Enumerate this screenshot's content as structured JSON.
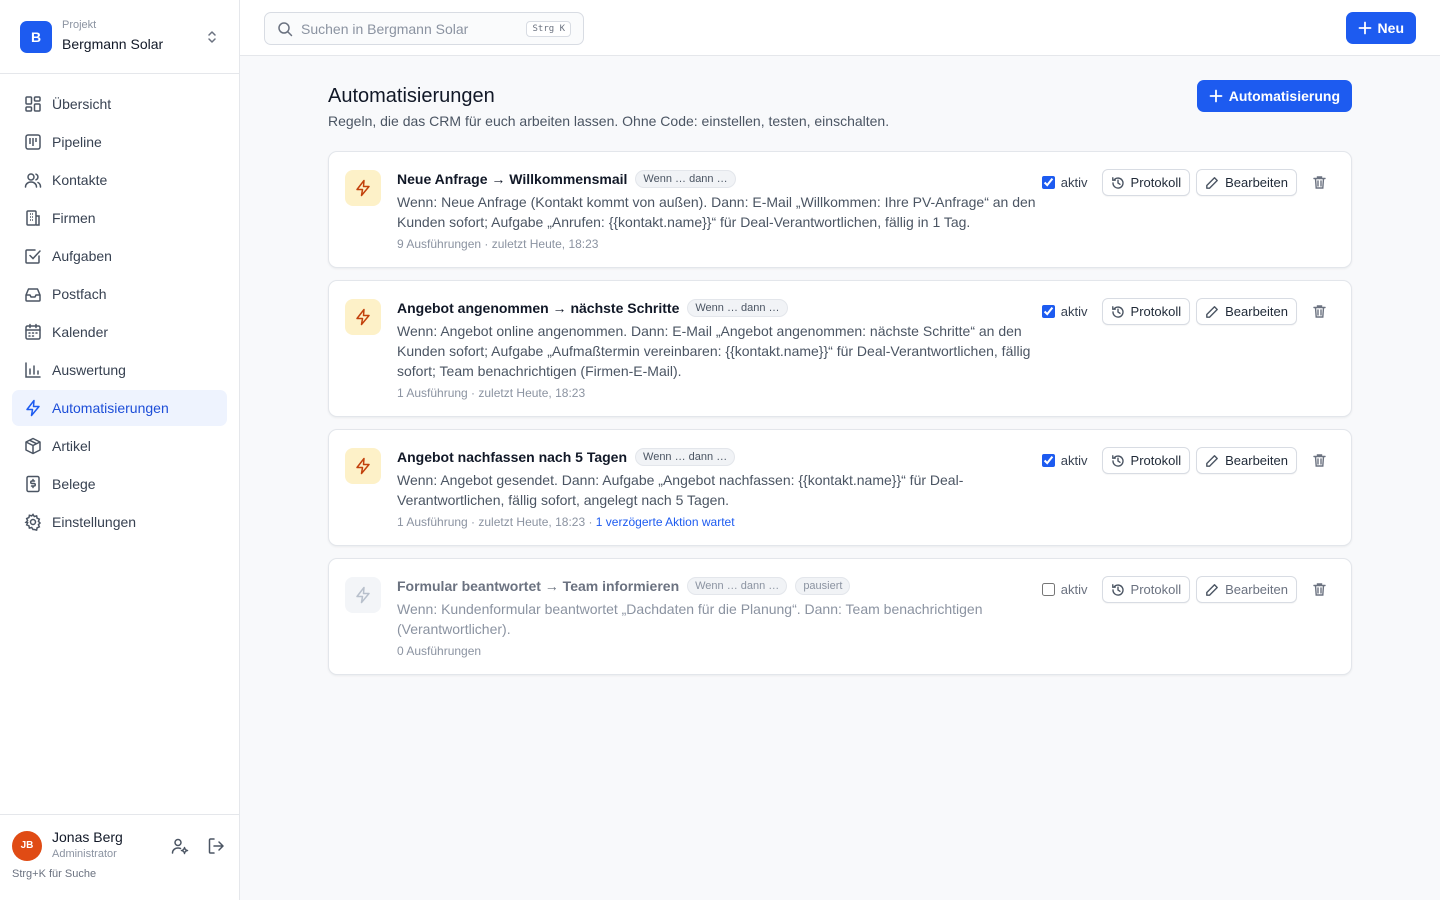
{
  "project": {
    "kicker": "Projekt",
    "name": "Bergmann Solar",
    "logo_letter": "B"
  },
  "nav": [
    {
      "label": "Übersicht",
      "icon": "dashboard-icon"
    },
    {
      "label": "Pipeline",
      "icon": "pipeline-icon"
    },
    {
      "label": "Kontakte",
      "icon": "users-icon"
    },
    {
      "label": "Firmen",
      "icon": "building-icon"
    },
    {
      "label": "Aufgaben",
      "icon": "checkbox-icon"
    },
    {
      "label": "Postfach",
      "icon": "inbox-icon"
    },
    {
      "label": "Kalender",
      "icon": "calendar-icon"
    },
    {
      "label": "Auswertung",
      "icon": "chart-icon"
    },
    {
      "label": "Automatisierungen",
      "icon": "bolt-icon",
      "active": true
    },
    {
      "label": "Artikel",
      "icon": "package-icon"
    },
    {
      "label": "Belege",
      "icon": "receipt-icon"
    },
    {
      "label": "Einstellungen",
      "icon": "gear-icon"
    }
  ],
  "user": {
    "initials": "JB",
    "name": "Jonas Berg",
    "role": "Administrator",
    "hint": "Strg+K für Suche"
  },
  "search": {
    "placeholder": "Suchen in Bergmann Solar",
    "shortcut": "Strg K"
  },
  "topbar": {
    "new_label": "Neu"
  },
  "page": {
    "title": "Automatisierungen",
    "subtitle": "Regeln, die das CRM für euch arbeiten lassen. Ohne Code: einstellen, testen, einschalten.",
    "add_label": "Automatisierung"
  },
  "labels": {
    "active": "aktiv",
    "log": "Protokoll",
    "edit": "Bearbeiten"
  },
  "automations": [
    {
      "title": "Neue Anfrage → Willkommensmail",
      "chip": "Wenn … dann …",
      "description": "Wenn: Neue Anfrage (Kontakt kommt von außen). Dann: E-Mail „Willkommen: Ihre PV-Anfrage“ an den Kunden sofort; Aufgabe „Anrufen: {{kontakt.name}}“ für Deal-Verantwortlichen, fällig in 1 Tag.",
      "meta": "9 Ausführungen · zuletzt Heute, 18:23",
      "active": true
    },
    {
      "title": "Angebot angenommen → nächste Schritte",
      "chip": "Wenn … dann …",
      "description": "Wenn: Angebot online angenommen. Dann: E-Mail „Angebot angenommen: nächste Schritte“ an den Kunden sofort; Aufgabe „Aufmaßtermin vereinbaren: {{kontakt.name}}“ für Deal-Verantwortlichen, fällig sofort; Team benachrichtigen (Firmen-E-Mail).",
      "meta": "1 Ausführung · zuletzt Heute, 18:23",
      "active": true
    },
    {
      "title": "Angebot nachfassen nach 5 Tagen",
      "chip": "Wenn … dann …",
      "description": "Wenn: Angebot gesendet. Dann: Aufgabe „Angebot nachfassen: {{kontakt.name}}“ für Deal-Verantwortlichen, fällig sofort, angelegt nach 5 Tagen.",
      "meta": "1 Ausführung · zuletzt Heute, 18:23 · ",
      "meta_extra": "1 verzögerte Aktion wartet",
      "active": true
    },
    {
      "title": "Formular beantwortet → Team informieren",
      "chip": "Wenn … dann …",
      "status_chip": "pausiert",
      "description": "Wenn: Kundenformular beantwortet „Dachdaten für die Planung“. Dann: Team benachrichtigen (Verantwortlicher).",
      "meta": "0 Ausführungen",
      "active": false
    }
  ],
  "colors": {
    "accent": "#1d5bf0",
    "avatar": "#e04b14",
    "bolt_bg": "#fdf1c8",
    "bolt_fg": "#c2410c"
  }
}
